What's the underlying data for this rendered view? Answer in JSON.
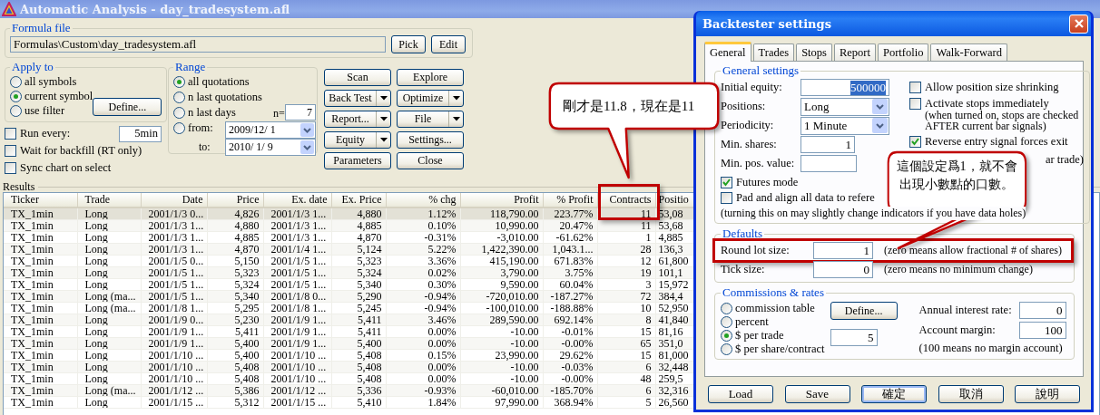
{
  "window": {
    "title": "Automatic Analysis - day_tradesystem.afl"
  },
  "formula_file": {
    "label": "Formula file",
    "value": "Formulas\\Custom\\day_tradesystem.afl",
    "buttons": [
      "Pick",
      "Edit"
    ]
  },
  "apply_to": {
    "label": "Apply to",
    "options": [
      {
        "label": "all symbols",
        "selected": false
      },
      {
        "label": "current symbol",
        "selected": true
      },
      {
        "label": "use filter",
        "selected": false
      }
    ],
    "define_button": "Define..."
  },
  "run_every": {
    "label": "Run every:",
    "checked": false,
    "value": "5min"
  },
  "options": [
    {
      "label": "Wait for backfill (RT only)",
      "checked": false
    },
    {
      "label": "Sync chart on select",
      "checked": false
    }
  ],
  "range": {
    "label": "Range",
    "options": [
      {
        "label": "all quotations",
        "selected": true
      },
      {
        "label": "n last quotations",
        "selected": false
      },
      {
        "label": "n last days",
        "selected": false
      },
      {
        "label": "from:",
        "selected": false
      }
    ],
    "n_label": "n=",
    "n_value": "7",
    "from_date": "2009/12/ 1",
    "to_label": "to:",
    "to_date": "2010/ 1/ 9"
  },
  "actions": [
    {
      "label": "Scan",
      "dropdown": false
    },
    {
      "label": "Explore",
      "dropdown": false
    },
    {
      "label": "Back Test",
      "dropdown": true
    },
    {
      "label": "Optimize",
      "dropdown": true
    },
    {
      "label": "Report...",
      "dropdown": true
    },
    {
      "label": "File",
      "dropdown": true
    },
    {
      "label": "Equity",
      "dropdown": true
    },
    {
      "label": "Settings...",
      "dropdown": false
    },
    {
      "label": "Parameters",
      "dropdown": false
    },
    {
      "label": "Close",
      "dropdown": false
    }
  ],
  "results": {
    "label": "Results",
    "columns": [
      "Ticker",
      "Trade",
      "Date",
      "Price",
      "Ex. date",
      "Ex. Price",
      "% chg",
      "Profit",
      "% Profit",
      "Contracts",
      "Positio"
    ],
    "rows": [
      {
        "selected": true,
        "cells": [
          "TX_1min",
          "Long",
          "2001/1/3 0...",
          "4,826",
          "2001/1/3 1...",
          "4,880",
          "1.12%",
          "118,790.00",
          "223.77%",
          "11",
          "53,08"
        ]
      },
      {
        "selected": false,
        "cells": [
          "TX_1min",
          "Long",
          "2001/1/3 1...",
          "4,880",
          "2001/1/3 1...",
          "4,885",
          "0.10%",
          "10,990.00",
          "20.47%",
          "11",
          "53,68"
        ]
      },
      {
        "selected": false,
        "cells": [
          "TX_1min",
          "Long",
          "2001/1/3 1...",
          "4,885",
          "2001/1/3 1...",
          "4,870",
          "-0.31%",
          "-3,010.00",
          "-61.62%",
          "1",
          "4,885"
        ]
      },
      {
        "selected": false,
        "cells": [
          "TX_1min",
          "Long",
          "2001/1/3 1...",
          "4,870",
          "2001/1/4 1...",
          "5,124",
          "5.22%",
          "1,422,390.00",
          "1,043.1...",
          "28",
          "136,3"
        ]
      },
      {
        "selected": false,
        "cells": [
          "TX_1min",
          "Long",
          "2001/1/5 0...",
          "5,150",
          "2001/1/5 1...",
          "5,323",
          "3.36%",
          "415,190.00",
          "671.83%",
          "12",
          "61,800"
        ]
      },
      {
        "selected": false,
        "cells": [
          "TX_1min",
          "Long",
          "2001/1/5 1...",
          "5,323",
          "2001/1/5 1...",
          "5,324",
          "0.02%",
          "3,790.00",
          "3.75%",
          "19",
          "101,1"
        ]
      },
      {
        "selected": false,
        "cells": [
          "TX_1min",
          "Long",
          "2001/1/5 1...",
          "5,324",
          "2001/1/5 1...",
          "5,340",
          "0.30%",
          "9,590.00",
          "60.04%",
          "3",
          "15,972"
        ]
      },
      {
        "selected": false,
        "cells": [
          "TX_1min",
          "Long (ma...",
          "2001/1/5 1...",
          "5,340",
          "2001/1/8 0...",
          "5,290",
          "-0.94%",
          "-720,010.00",
          "-187.27%",
          "72",
          "384,4"
        ]
      },
      {
        "selected": false,
        "cells": [
          "TX_1min",
          "Long (ma...",
          "2001/1/8 1...",
          "5,295",
          "2001/1/8 1...",
          "5,245",
          "-0.94%",
          "-100,010.00",
          "-188.88%",
          "10",
          "52,950"
        ]
      },
      {
        "selected": false,
        "cells": [
          "TX_1min",
          "Long",
          "2001/1/9 0...",
          "5,230",
          "2001/1/9 1...",
          "5,411",
          "3.46%",
          "289,590.00",
          "692.14%",
          "8",
          "41,840"
        ]
      },
      {
        "selected": false,
        "cells": [
          "TX_1min",
          "Long",
          "2001/1/9 1...",
          "5,411",
          "2001/1/9 1...",
          "5,411",
          "0.00%",
          "-10.00",
          "-0.01%",
          "15",
          "81,16"
        ]
      },
      {
        "selected": false,
        "cells": [
          "TX_1min",
          "Long",
          "2001/1/9 1...",
          "5,400",
          "2001/1/9 1...",
          "5,400",
          "0.00%",
          "-10.00",
          "-0.00%",
          "65",
          "351,0"
        ]
      },
      {
        "selected": false,
        "cells": [
          "TX_1min",
          "Long",
          "2001/1/10 ...",
          "5,400",
          "2001/1/10 ...",
          "5,408",
          "0.15%",
          "23,990.00",
          "29.62%",
          "15",
          "81,000"
        ]
      },
      {
        "selected": false,
        "cells": [
          "TX_1min",
          "Long",
          "2001/1/10 ...",
          "5,408",
          "2001/1/10 ...",
          "5,408",
          "0.00%",
          "-10.00",
          "-0.03%",
          "6",
          "32,448"
        ]
      },
      {
        "selected": false,
        "cells": [
          "TX_1min",
          "Long",
          "2001/1/10 ...",
          "5,408",
          "2001/1/10 ...",
          "5,408",
          "0.00%",
          "-10.00",
          "-0.00%",
          "48",
          "259,5"
        ]
      },
      {
        "selected": false,
        "cells": [
          "TX_1min",
          "Long (ma...",
          "2001/1/12 ...",
          "5,386",
          "2001/1/12 ...",
          "5,336",
          "-0.93%",
          "-60,010.00",
          "-185.70%",
          "6",
          "32,316"
        ]
      },
      {
        "selected": false,
        "cells": [
          "TX_1min",
          "Long",
          "2001/1/15 ...",
          "5,312",
          "2001/1/15 ...",
          "5,410",
          "1.84%",
          "97,990.00",
          "368.94%",
          "5",
          "26,560"
        ]
      }
    ]
  },
  "dialog": {
    "title": "Backtester settings",
    "tabs": [
      {
        "label": "General",
        "selected": true
      },
      {
        "label": "Trades",
        "selected": false
      },
      {
        "label": "Stops",
        "selected": false
      },
      {
        "label": "Report",
        "selected": false
      },
      {
        "label": "Portfolio",
        "selected": false
      },
      {
        "label": "Walk-Forward",
        "selected": false
      }
    ],
    "general_settings": {
      "label": "General settings",
      "fields": [
        {
          "label": "Initial equity:",
          "kind": "text",
          "value": "500000",
          "text_selected": true
        },
        {
          "label": "Positions:",
          "kind": "select",
          "value": "Long"
        },
        {
          "label": "Periodicity:",
          "kind": "select",
          "value": "1 Minute"
        },
        {
          "label": "Min. shares:",
          "kind": "text",
          "value": "1"
        },
        {
          "label": "Min. pos. value:",
          "kind": "text"
        }
      ],
      "side_options": [
        {
          "label": "Allow position size shrinking",
          "checked": false
        },
        {
          "label": "Activate stops immediately",
          "checked": false,
          "note": "(when turned on, stops are checked AFTER current bar signals)"
        },
        {
          "label": "Reverse entry signal forces exit",
          "checked": true
        }
      ],
      "partial_text": "ar trade)",
      "options": [
        {
          "label": "Futures mode",
          "checked": true
        },
        {
          "label": "Pad and align all data to refere",
          "checked": false
        }
      ],
      "note": "(turning this on may slightly change indicators if you have data holes)"
    },
    "defaults": {
      "label": "Defaults",
      "fields": [
        {
          "label": "Round lot size:",
          "value": "1",
          "note": "(zero means allow fractional # of shares)"
        },
        {
          "label": "Tick size:",
          "value": "0",
          "note": "(zero means no minimum change)"
        }
      ]
    },
    "commissions": {
      "label": "Commissions & rates",
      "options": [
        {
          "label": "commission table",
          "selected": false
        },
        {
          "label": "percent",
          "selected": false
        },
        {
          "label": "$ per trade",
          "selected": true
        },
        {
          "label": "$ per share/contract",
          "selected": false
        }
      ],
      "define_button": "Define...",
      "amount": "5",
      "fields": [
        {
          "label": "Annual interest rate:",
          "value": "0"
        },
        {
          "label": "Account margin:",
          "value": "100"
        }
      ],
      "note": "(100 means no margin account)"
    },
    "buttons": [
      {
        "label": "Load",
        "default": false
      },
      {
        "label": "Save",
        "default": false
      },
      {
        "label": "確定",
        "default": true
      },
      {
        "label": "取消",
        "default": false
      },
      {
        "label": "說明",
        "default": false
      }
    ]
  },
  "callouts": [
    {
      "text": "剛才是11.8，現在是11"
    },
    {
      "text": "這個設定爲1，就不會出現小數點的口數。"
    }
  ]
}
